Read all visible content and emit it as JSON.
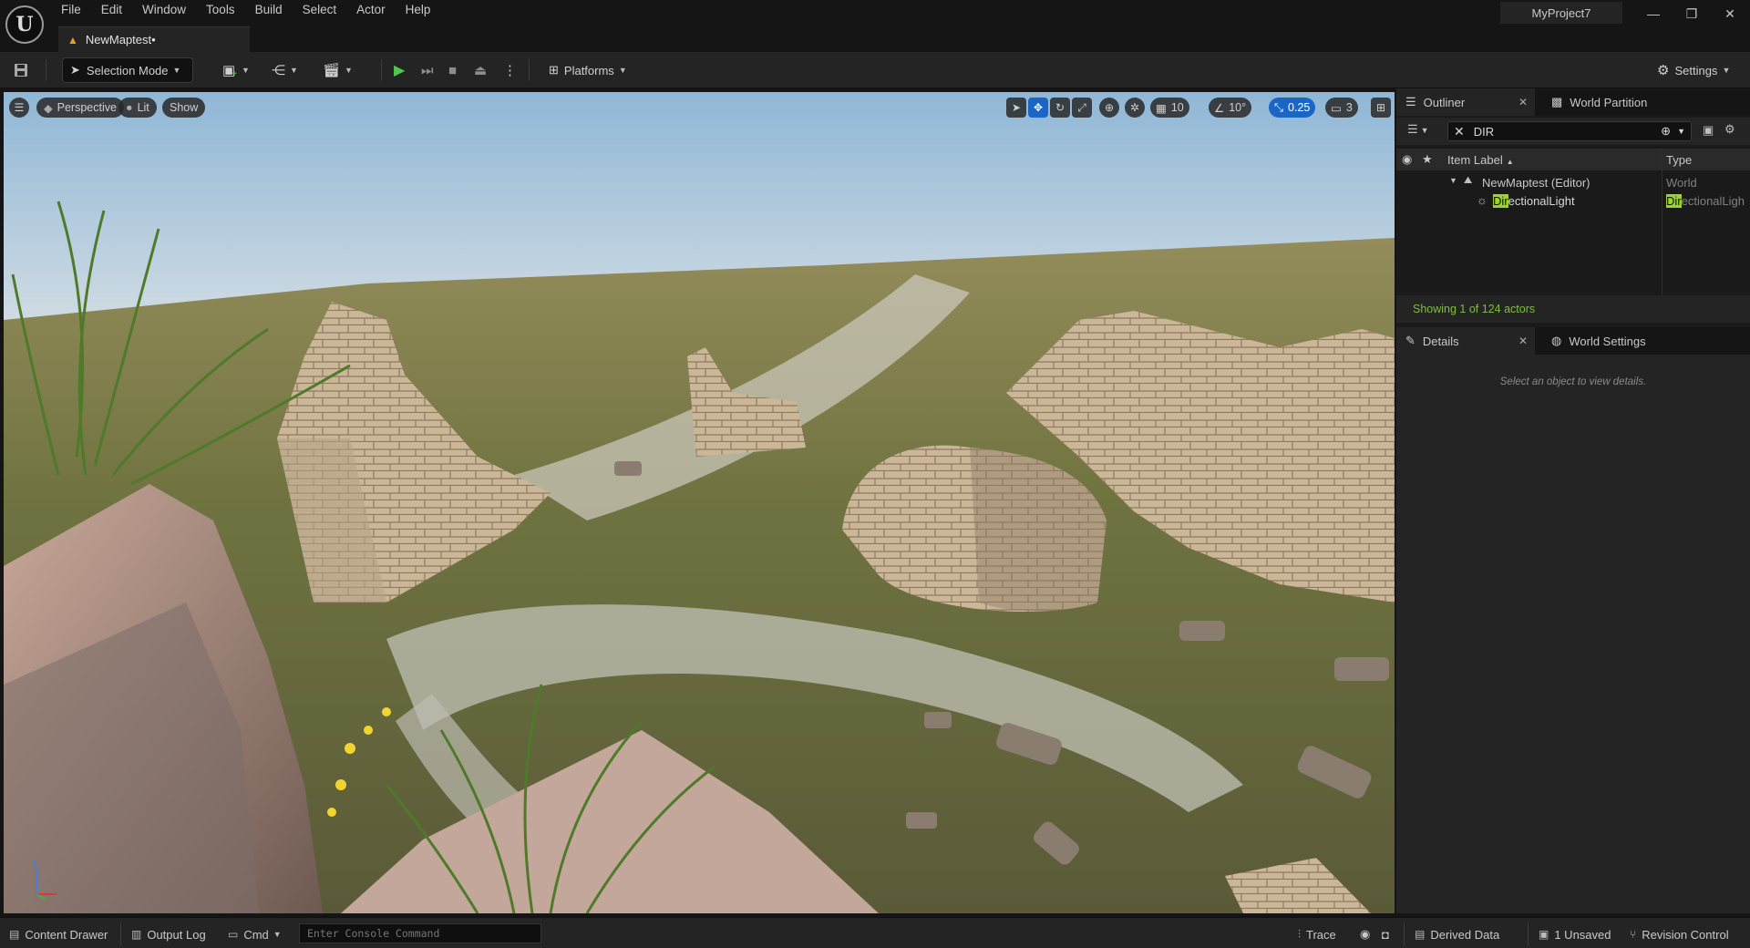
{
  "menu": [
    "File",
    "Edit",
    "Window",
    "Tools",
    "Build",
    "Select",
    "Actor",
    "Help"
  ],
  "document_tab": "NewMaptest•",
  "project_name": "MyProject7",
  "toolbar": {
    "selection_mode": "Selection Mode",
    "platforms": "Platforms",
    "settings": "Settings"
  },
  "viewport": {
    "perspective": "Perspective",
    "lit": "Lit",
    "show": "Show",
    "grid_snap": "10",
    "rotation_snap": "10°",
    "scale_snap": "0.25",
    "camera_speed": "3"
  },
  "outliner": {
    "tab_label": "Outliner",
    "tab_world_partition": "World Partition",
    "search_value": "DIR",
    "col_item_label": "Item Label",
    "col_type": "Type",
    "rows": [
      {
        "label": "NewMaptest (Editor)",
        "type": "World"
      },
      {
        "label_match": "Dir",
        "label_rest": "ectionalLight",
        "type_match": "Dir",
        "type_rest": "ectionalLigh"
      }
    ],
    "status": "Showing 1 of 124 actors"
  },
  "details": {
    "tab_label": "Details",
    "tab_world_settings": "World Settings",
    "empty_message": "Select an object to view details."
  },
  "statusbar": {
    "content_drawer": "Content Drawer",
    "output_log": "Output Log",
    "cmd": "Cmd",
    "console_placeholder": "Enter Console Command",
    "trace": "Trace",
    "derived_data": "Derived Data",
    "unsaved": "1 Unsaved",
    "revision_control": "Revision Control"
  },
  "colors": {
    "accent_blue": "#1b66c4",
    "play_green": "#4ec94e",
    "search_highlight": "#9bd42c",
    "status_green": "#7fbf3f"
  }
}
